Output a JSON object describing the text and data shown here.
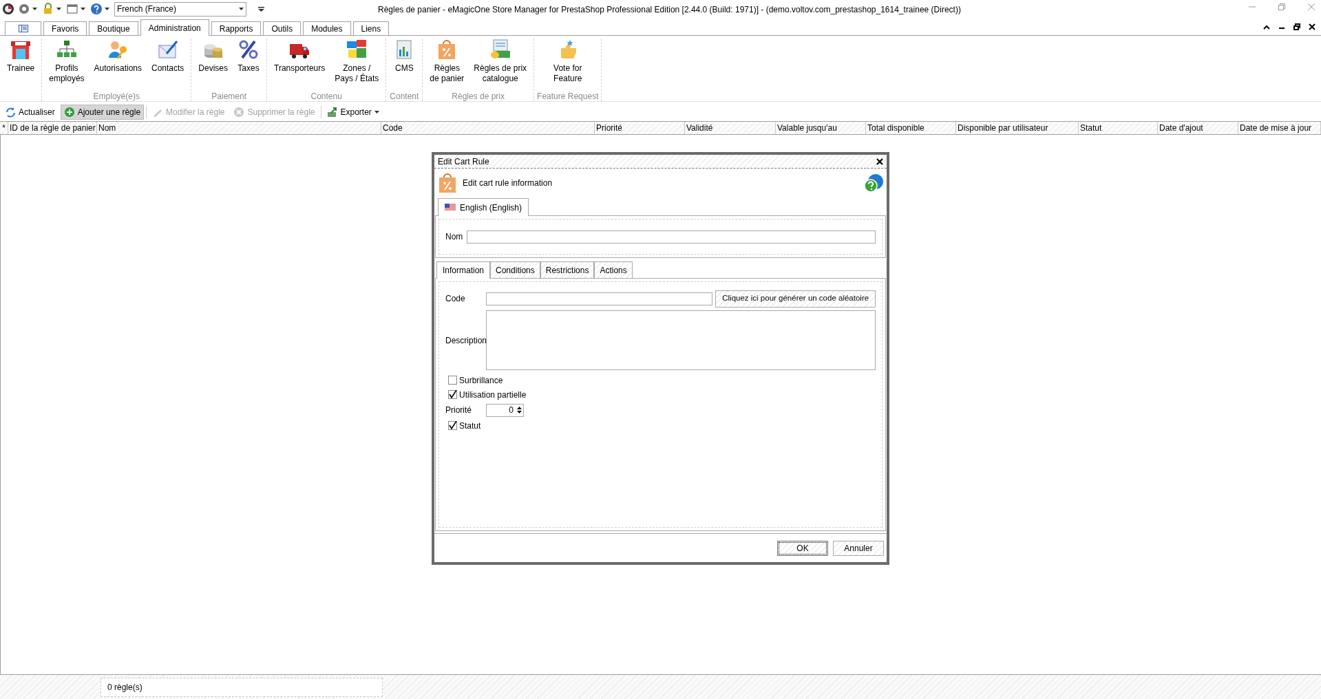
{
  "title_bar": {
    "language": "French (France)",
    "title": "Règles de panier - eMagicOne Store Manager for PrestaShop Professional Edition [2.44.0 (Build: 1971)] - (demo.voltov.com_prestashop_1614_trainee (Direct))"
  },
  "tabs": [
    {
      "label": "Favoris",
      "selected": false
    },
    {
      "label": "Boutique",
      "selected": false
    },
    {
      "label": "Administration",
      "selected": true
    },
    {
      "label": "Rapports",
      "selected": false
    },
    {
      "label": "Outils",
      "selected": false
    },
    {
      "label": "Modules",
      "selected": false
    },
    {
      "label": "Liens",
      "selected": false
    }
  ],
  "ribbon": [
    {
      "items": [
        "Trainee"
      ]
    },
    {
      "group": "Employé(e)s",
      "items": [
        "Profils\nemployés",
        "Autorisations",
        "Contacts"
      ]
    },
    {
      "group": "Paiement",
      "items": [
        "Devises",
        "Taxes"
      ]
    },
    {
      "group": "Contenu",
      "items": [
        "Transporteurs",
        "Zones /\nPays / États"
      ]
    },
    {
      "group": "Content",
      "items": [
        "CMS"
      ]
    },
    {
      "group": "Règles de prix",
      "items": [
        "Règles\nde panier",
        "Règles de prix\ncatalogue"
      ]
    },
    {
      "group": "Feature Request",
      "items": [
        "Vote for\nFeature"
      ]
    }
  ],
  "toolbar": [
    {
      "label": "Actualiser",
      "kind": "button",
      "disabled": false,
      "selected": false
    },
    {
      "label": "Ajouter une règle",
      "kind": "button",
      "disabled": false,
      "selected": true
    },
    {
      "label": "Modifier la règle",
      "kind": "button",
      "disabled": true,
      "selected": false
    },
    {
      "label": "Supprimer la règle",
      "kind": "button",
      "disabled": true,
      "selected": false
    },
    {
      "label": "Exporter",
      "kind": "dropdown",
      "disabled": false,
      "selected": false
    }
  ],
  "table": {
    "marker": "*",
    "columns": [
      "ID de la règle de panier",
      "Nom",
      "Code",
      "Priorité",
      "Validité",
      "Valable jusqu'au",
      "Total disponible",
      "Disponible par utilisateur",
      "Statut",
      "Date d'ajout",
      "Date de mise à jour"
    ]
  },
  "dialog": {
    "title": "Edit Cart Rule",
    "heading": "Edit cart rule information",
    "language_tab": "English (English)",
    "name_label": "Nom",
    "tabs": [
      {
        "label": "Information",
        "selected": true
      },
      {
        "label": "Conditions",
        "selected": false
      },
      {
        "label": "Restrictions",
        "selected": false
      },
      {
        "label": "Actions",
        "selected": false
      }
    ],
    "code_label": "Code",
    "generate_button": "Cliquez ici pour générer un code aléatoire",
    "description_label": "Description",
    "checkboxes_top": [
      {
        "label": "Surbrillance",
        "checked": false
      },
      {
        "label": "Utilisation partielle",
        "checked": true
      }
    ],
    "priority_label": "Priorité",
    "priority_value": "0",
    "checkboxes_bottom": [
      {
        "label": "Statut",
        "checked": true
      }
    ],
    "buttons": [
      "OK",
      "Annuler"
    ]
  },
  "status_bar": {
    "count": "0 règle(s)"
  }
}
